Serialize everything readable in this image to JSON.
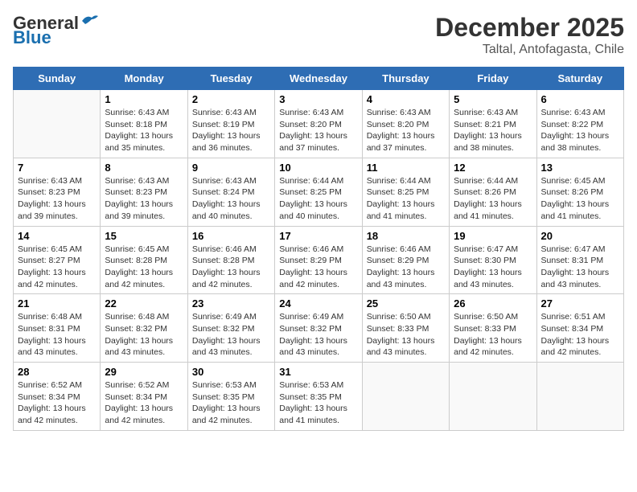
{
  "header": {
    "logo_general": "General",
    "logo_blue": "Blue",
    "title": "December 2025",
    "subtitle": "Taltal, Antofagasta, Chile"
  },
  "days_of_week": [
    "Sunday",
    "Monday",
    "Tuesday",
    "Wednesday",
    "Thursday",
    "Friday",
    "Saturday"
  ],
  "weeks": [
    [
      {
        "day": "",
        "info": ""
      },
      {
        "day": "1",
        "info": "Sunrise: 6:43 AM\nSunset: 8:18 PM\nDaylight: 13 hours\nand 35 minutes."
      },
      {
        "day": "2",
        "info": "Sunrise: 6:43 AM\nSunset: 8:19 PM\nDaylight: 13 hours\nand 36 minutes."
      },
      {
        "day": "3",
        "info": "Sunrise: 6:43 AM\nSunset: 8:20 PM\nDaylight: 13 hours\nand 37 minutes."
      },
      {
        "day": "4",
        "info": "Sunrise: 6:43 AM\nSunset: 8:20 PM\nDaylight: 13 hours\nand 37 minutes."
      },
      {
        "day": "5",
        "info": "Sunrise: 6:43 AM\nSunset: 8:21 PM\nDaylight: 13 hours\nand 38 minutes."
      },
      {
        "day": "6",
        "info": "Sunrise: 6:43 AM\nSunset: 8:22 PM\nDaylight: 13 hours\nand 38 minutes."
      }
    ],
    [
      {
        "day": "7",
        "info": "Sunrise: 6:43 AM\nSunset: 8:23 PM\nDaylight: 13 hours\nand 39 minutes."
      },
      {
        "day": "8",
        "info": "Sunrise: 6:43 AM\nSunset: 8:23 PM\nDaylight: 13 hours\nand 39 minutes."
      },
      {
        "day": "9",
        "info": "Sunrise: 6:43 AM\nSunset: 8:24 PM\nDaylight: 13 hours\nand 40 minutes."
      },
      {
        "day": "10",
        "info": "Sunrise: 6:44 AM\nSunset: 8:25 PM\nDaylight: 13 hours\nand 40 minutes."
      },
      {
        "day": "11",
        "info": "Sunrise: 6:44 AM\nSunset: 8:25 PM\nDaylight: 13 hours\nand 41 minutes."
      },
      {
        "day": "12",
        "info": "Sunrise: 6:44 AM\nSunset: 8:26 PM\nDaylight: 13 hours\nand 41 minutes."
      },
      {
        "day": "13",
        "info": "Sunrise: 6:45 AM\nSunset: 8:26 PM\nDaylight: 13 hours\nand 41 minutes."
      }
    ],
    [
      {
        "day": "14",
        "info": "Sunrise: 6:45 AM\nSunset: 8:27 PM\nDaylight: 13 hours\nand 42 minutes."
      },
      {
        "day": "15",
        "info": "Sunrise: 6:45 AM\nSunset: 8:28 PM\nDaylight: 13 hours\nand 42 minutes."
      },
      {
        "day": "16",
        "info": "Sunrise: 6:46 AM\nSunset: 8:28 PM\nDaylight: 13 hours\nand 42 minutes."
      },
      {
        "day": "17",
        "info": "Sunrise: 6:46 AM\nSunset: 8:29 PM\nDaylight: 13 hours\nand 42 minutes."
      },
      {
        "day": "18",
        "info": "Sunrise: 6:46 AM\nSunset: 8:29 PM\nDaylight: 13 hours\nand 43 minutes."
      },
      {
        "day": "19",
        "info": "Sunrise: 6:47 AM\nSunset: 8:30 PM\nDaylight: 13 hours\nand 43 minutes."
      },
      {
        "day": "20",
        "info": "Sunrise: 6:47 AM\nSunset: 8:31 PM\nDaylight: 13 hours\nand 43 minutes."
      }
    ],
    [
      {
        "day": "21",
        "info": "Sunrise: 6:48 AM\nSunset: 8:31 PM\nDaylight: 13 hours\nand 43 minutes."
      },
      {
        "day": "22",
        "info": "Sunrise: 6:48 AM\nSunset: 8:32 PM\nDaylight: 13 hours\nand 43 minutes."
      },
      {
        "day": "23",
        "info": "Sunrise: 6:49 AM\nSunset: 8:32 PM\nDaylight: 13 hours\nand 43 minutes."
      },
      {
        "day": "24",
        "info": "Sunrise: 6:49 AM\nSunset: 8:32 PM\nDaylight: 13 hours\nand 43 minutes."
      },
      {
        "day": "25",
        "info": "Sunrise: 6:50 AM\nSunset: 8:33 PM\nDaylight: 13 hours\nand 43 minutes."
      },
      {
        "day": "26",
        "info": "Sunrise: 6:50 AM\nSunset: 8:33 PM\nDaylight: 13 hours\nand 42 minutes."
      },
      {
        "day": "27",
        "info": "Sunrise: 6:51 AM\nSunset: 8:34 PM\nDaylight: 13 hours\nand 42 minutes."
      }
    ],
    [
      {
        "day": "28",
        "info": "Sunrise: 6:52 AM\nSunset: 8:34 PM\nDaylight: 13 hours\nand 42 minutes."
      },
      {
        "day": "29",
        "info": "Sunrise: 6:52 AM\nSunset: 8:34 PM\nDaylight: 13 hours\nand 42 minutes."
      },
      {
        "day": "30",
        "info": "Sunrise: 6:53 AM\nSunset: 8:35 PM\nDaylight: 13 hours\nand 42 minutes."
      },
      {
        "day": "31",
        "info": "Sunrise: 6:53 AM\nSunset: 8:35 PM\nDaylight: 13 hours\nand 41 minutes."
      },
      {
        "day": "",
        "info": ""
      },
      {
        "day": "",
        "info": ""
      },
      {
        "day": "",
        "info": ""
      }
    ]
  ]
}
